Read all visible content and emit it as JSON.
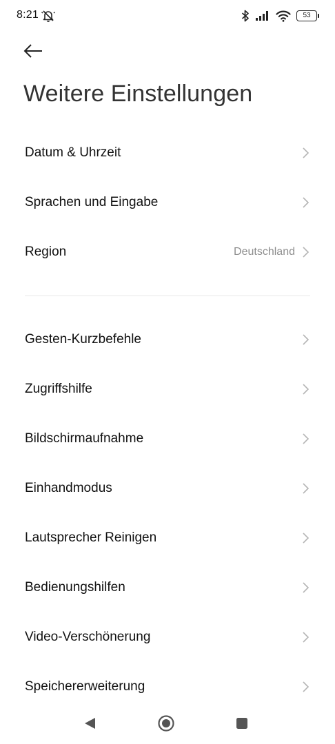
{
  "status_bar": {
    "time": "8:21",
    "battery_level": "53",
    "icons": [
      "mute-icon",
      "bluetooth-icon",
      "signal-icon",
      "wifi-icon",
      "battery-icon"
    ]
  },
  "header": {
    "back_icon": "back-arrow-icon",
    "title": "Weitere Einstellungen"
  },
  "groups": [
    {
      "items": [
        {
          "label": "Datum & Uhrzeit",
          "value": ""
        },
        {
          "label": "Sprachen und Eingabe",
          "value": ""
        },
        {
          "label": "Region",
          "value": "Deutschland"
        }
      ]
    },
    {
      "items": [
        {
          "label": "Gesten-Kurzbefehle",
          "value": ""
        },
        {
          "label": "Zugriffshilfe",
          "value": ""
        },
        {
          "label": "Bildschirmaufnahme",
          "value": ""
        },
        {
          "label": "Einhandmodus",
          "value": ""
        },
        {
          "label": "Lautsprecher Reinigen",
          "value": ""
        },
        {
          "label": "Bedienungshilfen",
          "value": ""
        },
        {
          "label": "Video-Verschönerung",
          "value": ""
        },
        {
          "label": "Speichererweiterung",
          "value": ""
        }
      ]
    }
  ],
  "nav_bar": {
    "icons": [
      "back-triangle-icon",
      "home-circle-icon",
      "recents-square-icon"
    ]
  },
  "colors": {
    "background": "#ffffff",
    "text_primary": "#111111",
    "text_secondary": "#8e8e8e",
    "chevron": "#b5b5b5",
    "divider": "#e6e6e6"
  }
}
